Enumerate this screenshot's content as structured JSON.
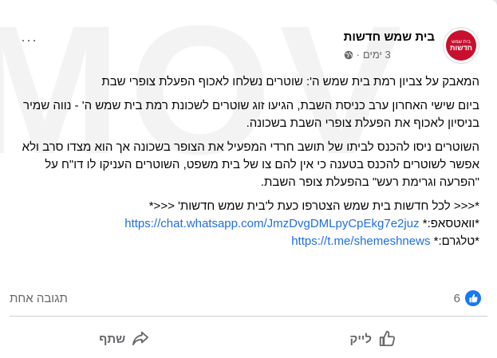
{
  "watermark": "MOV",
  "post": {
    "page_name": "בית שמש חדשות",
    "avatar_text_top": "בית שמש",
    "avatar_text_main": "חדשות",
    "time": "3 ימים",
    "more": "···",
    "paragraphs": [
      "המאבק על צביון רמת בית שמש ה': שוטרים נשלחו לאכוף הפעלת צופרי שבת",
      "ביום שישי האחרון ערב כניסת השבת, הגיעו זוג שוטרים לשכונת רמת בית שמש ה' - נווה שמיר בניסיון לאכוף את הפעלת צופרי השבת בשכונה.",
      "השוטרים ניסו להכנס לביתו של תושב חרדי המפעיל את הצופר בשכונה אך הוא מצדו סרב ולא אפשר לשוטרים להכנס בטענה כי אין להם צו של בית משפט, השוטרים העניקו לו דו\"ח על \"הפרעה וגרימת רעש\" בהפעלת צופר השבת."
    ],
    "join_line": "*<<< לכל חדשות בית שמש הצטרפו כעת ל'בית שמש חדשות' <<<*",
    "whatsapp_label": "*וואטסאפ:*",
    "whatsapp_url": "https://chat.whatsapp.com/JmzDvgDMLpyCpEkg7e2juz",
    "telegram_label": "*טלגרם:*",
    "telegram_url": "https://t.me/shemeshnews"
  },
  "stats": {
    "likes_count": "6",
    "comments": "תגובה אחת"
  },
  "actions": {
    "like": "לייק",
    "share": "שתף"
  },
  "colors": {
    "link": "#216fdb",
    "like_blue": "#1877f2",
    "brand_red": "#c8102e"
  }
}
